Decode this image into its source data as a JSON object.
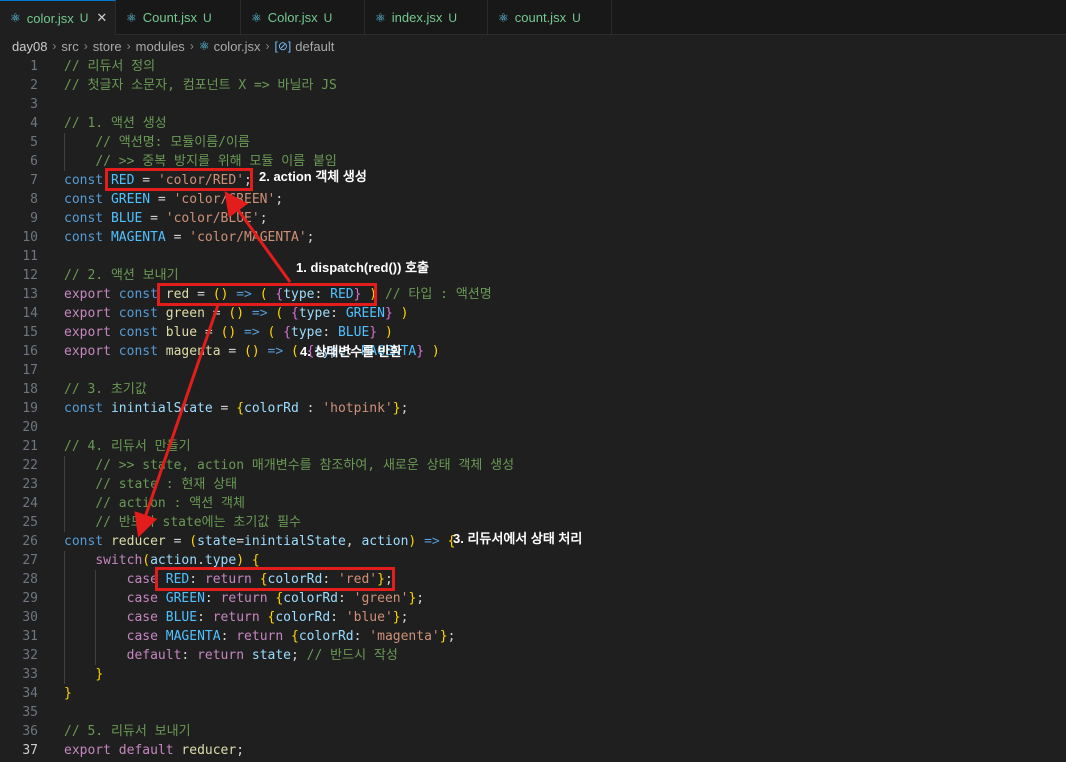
{
  "tabs": [
    {
      "name": "color.jsx",
      "status": "U",
      "close": "✕",
      "active": true
    },
    {
      "name": "Count.jsx",
      "status": "U",
      "active": false
    },
    {
      "name": "Color.jsx",
      "status": "U",
      "active": false
    },
    {
      "name": "index.jsx",
      "status": "U",
      "active": false
    },
    {
      "name": "count.jsx",
      "status": "U",
      "active": false
    }
  ],
  "breadcrumb": [
    "day08",
    "src",
    "store",
    "modules",
    "color.jsx",
    "default"
  ],
  "current_line": 37,
  "annotations": {
    "a1": "1. dispatch(red())  호출",
    "a2": "2. action 객체 생성",
    "a3": "3. 리듀서에서 상태 처리",
    "a4": "4. 상태변수를 반환"
  },
  "code": [
    "// 리듀서 정의",
    "// 첫글자 소문자, 컴포넌트 X => 바닐라 JS",
    "",
    "// 1. 액션 생성",
    "    // 액션명: 모듈이름/이름",
    "    // >> 중복 방지를 위해 모듈 이름 붙임",
    "const RED = 'color/RED';",
    "const GREEN = 'color/GREEN';",
    "const BLUE = 'color/BLUE';",
    "const MAGENTA = 'color/MAGENTA';",
    "",
    "// 2. 액션 보내기",
    "export const red = () => ( {type: RED} ) // 타입 : 액션명",
    "export const green = () => ( {type: GREEN} )",
    "export const blue = () => ( {type: BLUE} )",
    "export const magenta = () => ( {type: MAGENTA} )",
    "",
    "// 3. 초기값",
    "const inintialState = {colorRd : 'hotpink'};",
    "",
    "// 4. 리듀서 만들기",
    "    // >> state, action 매개변수를 참조하여, 새로운 상태 객체 생성",
    "    // state : 현재 상태",
    "    // action : 액션 객체",
    "    // 반드시 state에는 초기값 필수",
    "const reducer = (state=inintialState, action) => {",
    "    switch(action.type) {",
    "        case RED: return {colorRd: 'red'};",
    "        case GREEN: return {colorRd: 'green'};",
    "        case BLUE: return {colorRd: 'blue'};",
    "        case MAGENTA: return {colorRd: 'magenta'};",
    "        default: return state; // 반드시 작성",
    "    }",
    "}",
    "",
    "// 5. 리듀서 보내기",
    "export default reducer;"
  ]
}
